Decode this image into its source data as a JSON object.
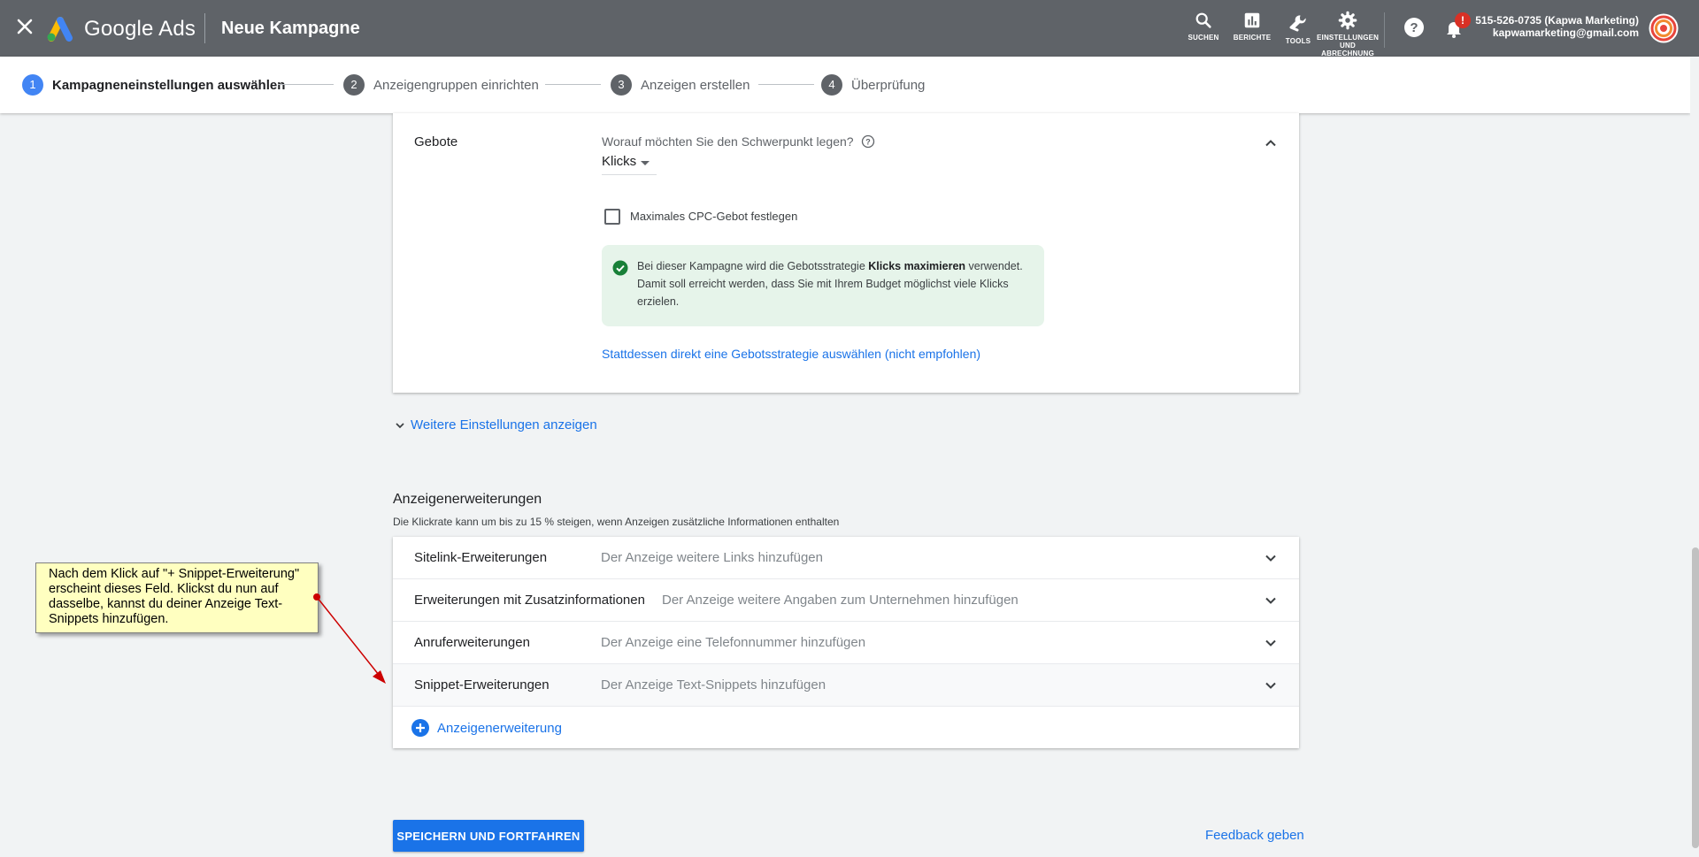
{
  "topbar": {
    "brand": "Google Ads",
    "campaign_title": "Neue Kampagne",
    "tools": [
      {
        "icon": "search-icon",
        "label": "SUCHEN"
      },
      {
        "icon": "bar-chart-icon",
        "label": "BERICHTE"
      },
      {
        "icon": "wrench-icon",
        "label": "TOOLS"
      },
      {
        "icon": "gear-icon",
        "label": "EINSTELLUNGEN UND ABRECHNUNG"
      }
    ],
    "notification_badge": "!",
    "account_name": "515-526-0735 (Kapwa Marketing)",
    "account_email": "kapwamarketing@gmail.com"
  },
  "stepper": {
    "steps": [
      {
        "number": "1",
        "label": "Kampagneneinstellungen auswählen",
        "active": true
      },
      {
        "number": "2",
        "label": "Anzeigengruppen einrichten",
        "active": false
      },
      {
        "number": "3",
        "label": "Anzeigen erstellen",
        "active": false
      },
      {
        "number": "4",
        "label": "Überprüfung",
        "active": false
      }
    ]
  },
  "bidding": {
    "section_label": "Gebote",
    "question": "Worauf möchten Sie den Schwerpunkt legen?",
    "focus_value": "Klicks",
    "max_cpc_label": "Maximales CPC-Gebot festlegen",
    "max_cpc_checked": false,
    "info_prefix": "Bei dieser Kampagne wird die Gebotsstrategie ",
    "info_strategy": "Klicks maximieren",
    "info_suffix": " verwendet. Damit soll erreicht werden, dass Sie mit Ihrem Budget möglichst viele Klicks erzielen.",
    "strategy_link": "Stattdessen direkt eine Gebotsstrategie auswählen (nicht empfohlen)"
  },
  "more_settings_link": "Weitere Einstellungen anzeigen",
  "extensions": {
    "title": "Anzeigenerweiterungen",
    "subtitle": "Die Klickrate kann um bis zu 15 % steigen, wenn Anzeigen zusätzliche Informationen enthalten",
    "rows": [
      {
        "name": "Sitelink-Erweiterungen",
        "desc": "Der Anzeige weitere Links hinzufügen"
      },
      {
        "name": "Erweiterungen mit Zusatzinformationen",
        "desc": "Der Anzeige weitere Angaben zum Unternehmen hinzufügen"
      },
      {
        "name": "Anruferweiterungen",
        "desc": "Der Anzeige eine Telefonnummer hinzufügen"
      },
      {
        "name": "Snippet-Erweiterungen",
        "desc": "Der Anzeige Text-Snippets hinzufügen"
      }
    ],
    "add_label": "Anzeigenerweiterung"
  },
  "footer": {
    "save_label": "SPEICHERN UND FORTFAHREN",
    "feedback_label": "Feedback geben"
  },
  "annotation": {
    "text": "Nach dem Klick auf \"+ Snippet-Erweiterung\" erscheint dieses Feld. Klickst du nun auf dasselbe, kannst du deiner Anzeige Text-Snippets hinzufügen."
  },
  "colors": {
    "topbar": "#5f6368",
    "accent": "#1a73e8",
    "success_bg": "#e6f4ea",
    "success_icon": "#188038",
    "note_bg": "#ffffc0",
    "arrow": "#cc0000"
  }
}
